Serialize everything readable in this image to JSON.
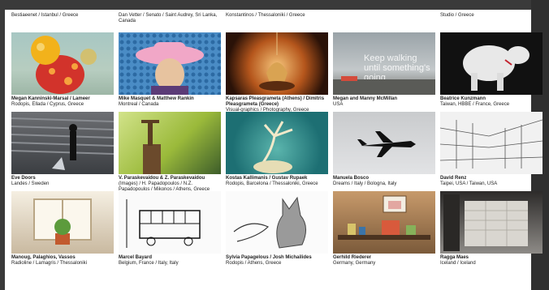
{
  "top_captions": [
    "Bestiaeenet / Istanbul / Greece",
    "Dan Vetter / Senato / Saint Audrey, Sri Lanka, Canada",
    "Konstantinos / Thessaloniki / Greece",
    "",
    "Studio / Greece"
  ],
  "rows": [
    [
      {
        "title": "Megan Kanninski-Marsal / Lameer",
        "sub": "Rodopis, Ellada / Cyprus, Greece"
      },
      {
        "title": "Mike Masquet & Matthew Rankin",
        "sub": "Montreal / Canada"
      },
      {
        "title": "Kapsaras Pleasgrameta (Athens) / Dimitris Pleasgrameta (Greece)",
        "sub": "Visual-graphics / Photography, Greece"
      },
      {
        "title": "Megan and Manny McMillan",
        "sub": "USA",
        "overlay": "Keep walking until something's going"
      },
      {
        "title": "Beatrice Kunzmann",
        "sub": "Taiwan, HBBE / France, Greece"
      }
    ],
    [
      {
        "title": "Eve Doors",
        "sub": "Landes / Sweden"
      },
      {
        "title": "V. Paraskevaidou & Z. Paraskevaidou",
        "sub": "(Images) / H. Papadopoulos / N.Z. Papadopoulos / Mikonos / Athens, Greece"
      },
      {
        "title": "Kostas Kallimanis / Gustav Rupaek",
        "sub": "Rodopis, Barcelona / Thessaloniki, Greece"
      },
      {
        "title": "Manuela Bosco",
        "sub": "Dreams / Italy / Bologna, Italy"
      },
      {
        "title": "David Renz",
        "sub": "Taipei, USA / Taiwan, USA"
      }
    ],
    [
      {
        "title": "Manoug, Palaghios, Vassos",
        "sub": "Radioline / Lamagris / Thessaloniki"
      },
      {
        "title": "Marcel Bayard",
        "sub": "Belgium, France / Italy, Italy"
      },
      {
        "title": "Sylvia Papagelous / Josh Michailides",
        "sub": "Rodopis / Athens, Greece"
      },
      {
        "title": "Gerhild Riederer",
        "sub": "Germany, Germany"
      },
      {
        "title": "Ragga Maes",
        "sub": "Iceland / Iceland"
      }
    ]
  ]
}
